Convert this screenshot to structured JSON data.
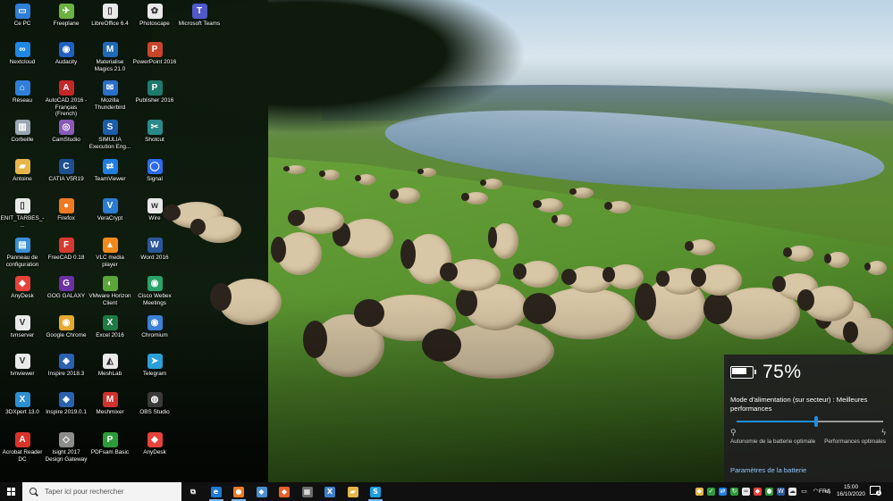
{
  "desktop": {
    "icons": [
      {
        "label": "Ce PC",
        "icon": "computer-icon",
        "color": "#2f7fd8",
        "glyph": "▭"
      },
      {
        "label": "Nextcloud",
        "icon": "nextcloud-icon",
        "color": "#1e88e5",
        "glyph": "∞"
      },
      {
        "label": "Réseau",
        "icon": "network-icon",
        "color": "#2f7fd8",
        "glyph": "⌂"
      },
      {
        "label": "Corbeille",
        "icon": "recycle-bin-icon",
        "color": "#9aa7b3",
        "glyph": "▥"
      },
      {
        "label": "Antoine",
        "icon": "user-folder-icon",
        "color": "#e6b64a",
        "glyph": "▰"
      },
      {
        "label": "ENIT_TARBES_-...",
        "icon": "document-icon",
        "color": "#e9e9e9",
        "glyph": "▯"
      },
      {
        "label": "Panneau de configuration",
        "icon": "control-panel-icon",
        "color": "#3a8fd6",
        "glyph": "▤"
      },
      {
        "label": "AnyDesk",
        "icon": "anydesk-icon",
        "color": "#e5423a",
        "glyph": "◆"
      },
      {
        "label": "tvnserver",
        "icon": "tvnserver-icon",
        "color": "#e9e9e9",
        "glyph": "V"
      },
      {
        "label": "tvnviewer",
        "icon": "tvnviewer-icon",
        "color": "#e9e9e9",
        "glyph": "V"
      },
      {
        "label": "3DXpert 13.0",
        "icon": "3dxpert-icon",
        "color": "#2d8fd0",
        "glyph": "X"
      },
      {
        "label": "Acrobat Reader DC",
        "icon": "acrobat-icon",
        "color": "#d9342b",
        "glyph": "A"
      },
      {
        "label": "Freeplane",
        "icon": "freeplane-icon",
        "color": "#6bb144",
        "glyph": "✈"
      },
      {
        "label": "Audacity",
        "icon": "audacity-icon",
        "color": "#1f5fbf",
        "glyph": "◉"
      },
      {
        "label": "AutoCAD 2016 - Français (French)",
        "icon": "autocad-icon",
        "color": "#c5262a",
        "glyph": "A"
      },
      {
        "label": "CamStudio",
        "icon": "camstudio-icon",
        "color": "#8a5ab8",
        "glyph": "◎"
      },
      {
        "label": "CATIA V5R19",
        "icon": "catia-icon",
        "color": "#1d4f91",
        "glyph": "C"
      },
      {
        "label": "Firefox",
        "icon": "firefox-icon",
        "color": "#f07a22",
        "glyph": "●"
      },
      {
        "label": "FreeCAD 0.18",
        "icon": "freecad-icon",
        "color": "#d63a2e",
        "glyph": "F"
      },
      {
        "label": "GOG GALAXY",
        "icon": "gog-galaxy-icon",
        "color": "#6b2fa6",
        "glyph": "G"
      },
      {
        "label": "Google Chrome",
        "icon": "chrome-icon",
        "color": "#e5a92f",
        "glyph": "◉"
      },
      {
        "label": "Inspire 2018.3",
        "icon": "inspire-icon",
        "color": "#2a61b0",
        "glyph": "◈"
      },
      {
        "label": "Inspire 2019.0.1",
        "icon": "inspire-icon",
        "color": "#2a61b0",
        "glyph": "◈"
      },
      {
        "label": "Isight 2017 Design Gateway",
        "icon": "isight-icon",
        "color": "#8c8c8c",
        "glyph": "◇"
      },
      {
        "label": "LibreOffice 6.4",
        "icon": "libreoffice-icon",
        "color": "#e9e9e9",
        "glyph": "▯"
      },
      {
        "label": "Materialise Magics 21.0",
        "icon": "magics-icon",
        "color": "#1e6ab8",
        "glyph": "M"
      },
      {
        "label": "Mozilla Thunderbird",
        "icon": "thunderbird-icon",
        "color": "#2b6fc7",
        "glyph": "✉"
      },
      {
        "label": "SIMULIA Execution Eng...",
        "icon": "simulia-icon",
        "color": "#1d5da8",
        "glyph": "S"
      },
      {
        "label": "TeamViewer",
        "icon": "teamviewer-icon",
        "color": "#1f7fe0",
        "glyph": "⇄"
      },
      {
        "label": "VeraCrypt",
        "icon": "veracrypt-icon",
        "color": "#2b7bd1",
        "glyph": "V"
      },
      {
        "label": "VLC media player",
        "icon": "vlc-icon",
        "color": "#f08a1c",
        "glyph": "▲"
      },
      {
        "label": "VMware Horizon Client",
        "icon": "vmware-icon",
        "color": "#5aa63a",
        "glyph": "◐"
      },
      {
        "label": "Excel 2016",
        "icon": "excel-icon",
        "color": "#1f7a45",
        "glyph": "X"
      },
      {
        "label": "MeshLab",
        "icon": "meshlab-icon",
        "color": "#e9e9e9",
        "glyph": "◭"
      },
      {
        "label": "Meshmixer",
        "icon": "meshmixer-icon",
        "color": "#d1322d",
        "glyph": "M"
      },
      {
        "label": "PDFsam Basic",
        "icon": "pdfsam-icon",
        "color": "#2e9b3a",
        "glyph": "P"
      },
      {
        "label": "Photoscape",
        "icon": "photoscape-icon",
        "color": "#e9e9e9",
        "glyph": "✿"
      },
      {
        "label": "PowerPoint 2016",
        "icon": "powerpoint-icon",
        "color": "#c9452a",
        "glyph": "P"
      },
      {
        "label": "Publisher 2016",
        "icon": "publisher-icon",
        "color": "#1f7a6e",
        "glyph": "P"
      },
      {
        "label": "Shotcut",
        "icon": "shotcut-icon",
        "color": "#2a8a8a",
        "glyph": "✂"
      },
      {
        "label": "Signal",
        "icon": "signal-icon",
        "color": "#2c6bed",
        "glyph": "◯"
      },
      {
        "label": "Wire",
        "icon": "wire-icon",
        "color": "#e9e9e9",
        "glyph": "w"
      },
      {
        "label": "Word 2016",
        "icon": "word-icon",
        "color": "#2b579a",
        "glyph": "W"
      },
      {
        "label": "Cisco Webex Meetings",
        "icon": "webex-icon",
        "color": "#29a36a",
        "glyph": "◉"
      },
      {
        "label": "Chromium",
        "icon": "chromium-icon",
        "color": "#3b7fd8",
        "glyph": "◉"
      },
      {
        "label": "Telegram",
        "icon": "telegram-icon",
        "color": "#2a9fd8",
        "glyph": "➤"
      },
      {
        "label": "OBS Studio",
        "icon": "obs-icon",
        "color": "#3a3a3a",
        "glyph": "◍"
      },
      {
        "label": "AnyDesk",
        "icon": "anydesk-icon",
        "color": "#e5423a",
        "glyph": "◆"
      },
      {
        "label": "Microsoft Teams",
        "icon": "teams-icon",
        "color": "#5059c9",
        "glyph": "T"
      }
    ]
  },
  "battery_flyout": {
    "percent_text": "75%",
    "charge_level": 0.75,
    "mode_text": "Mode d'alimentation (sur secteur) : Meilleures performances",
    "slider_level": 0.54,
    "left_label": "Autonomie de la batterie optimale",
    "right_label": "Performances optimales",
    "settings_link": "Paramètres de la batterie",
    "accent": "#1e8fe0"
  },
  "taskbar": {
    "search_placeholder": "Taper ici pour rechercher",
    "apps": [
      {
        "name": "task-view",
        "icon": "task-view-icon",
        "color": "#101010",
        "glyph": "⧉",
        "active": false
      },
      {
        "name": "edge",
        "icon": "edge-icon",
        "color": "#1f7ad6",
        "glyph": "e",
        "active": true
      },
      {
        "name": "firefox",
        "icon": "firefox-icon",
        "color": "#f07a22",
        "glyph": "●",
        "active": true
      },
      {
        "name": "app-blue",
        "icon": "window-app-icon",
        "color": "#4a8ed0",
        "glyph": "◆",
        "active": false
      },
      {
        "name": "app-orange",
        "icon": "app-orange-icon",
        "color": "#e5622a",
        "glyph": "◆",
        "active": false
      },
      {
        "name": "calculator",
        "icon": "calculator-icon",
        "color": "#6d6d6d",
        "glyph": "▦",
        "active": false
      },
      {
        "name": "xming",
        "icon": "xming-icon",
        "color": "#3d7fc9",
        "glyph": "X",
        "active": false
      },
      {
        "name": "file-explorer",
        "icon": "file-explorer-icon",
        "color": "#e6b64a",
        "glyph": "▰",
        "active": false
      },
      {
        "name": "skype",
        "icon": "skype-icon",
        "color": "#1f9ee0",
        "glyph": "S",
        "active": true
      }
    ],
    "tray": [
      {
        "icon": "security-shield-icon",
        "color": "#e6b64a",
        "glyph": "◆"
      },
      {
        "icon": "green-check-icon",
        "color": "#2e9b3a",
        "glyph": "✓"
      },
      {
        "icon": "teamviewer-tray-icon",
        "color": "#1f7fe0",
        "glyph": "⇄"
      },
      {
        "icon": "update-icon",
        "color": "#2e9b3a",
        "glyph": "↻"
      },
      {
        "icon": "nextcloud-tray-icon",
        "color": "#e9e9e9",
        "glyph": "∞"
      },
      {
        "icon": "anydesk-tray-icon",
        "color": "#e5423a",
        "glyph": "◆"
      },
      {
        "icon": "meeting-icon",
        "color": "#2e9b3a",
        "glyph": "●"
      },
      {
        "icon": "word-tray-icon",
        "color": "#2b579a",
        "glyph": "W"
      },
      {
        "icon": "onedrive-icon",
        "color": "#e9e9e9",
        "glyph": "☁"
      },
      {
        "icon": "battery-tray-icon",
        "color": "#101010",
        "glyph": "▭"
      },
      {
        "icon": "wifi-icon",
        "color": "#101010",
        "glyph": "◠"
      },
      {
        "icon": "volume-icon",
        "color": "#101010",
        "glyph": "◁"
      }
    ],
    "language": "FRA",
    "time": "15:00",
    "date": "16/10/2020",
    "notification_count": "1"
  }
}
